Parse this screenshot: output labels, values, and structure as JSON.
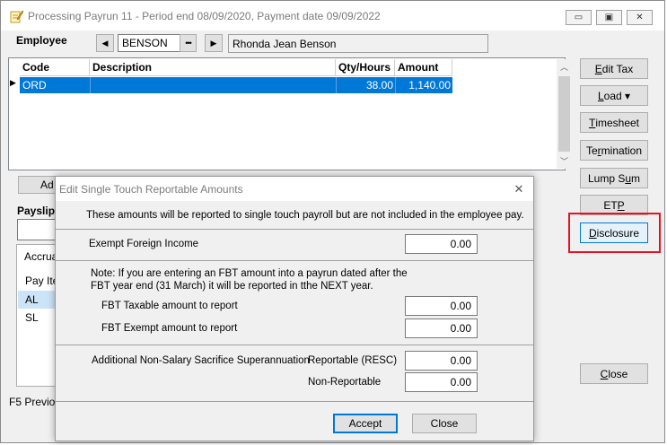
{
  "window": {
    "title": "Processing Payrun 11 - Period end 08/09/2020, Payment date 09/09/2022",
    "minimize_glyph": "▭",
    "restore_glyph": "▣",
    "close_glyph": "✕"
  },
  "employee": {
    "label": "Employee",
    "prev_glyph": "◀",
    "code": "BENSON",
    "lookup_glyph": "•••",
    "next_glyph": "▶",
    "name": "Rhonda Jean Benson"
  },
  "grid": {
    "columns": [
      "Code",
      "Description",
      "Qty/Hours",
      "Amount"
    ],
    "rows": [
      {
        "code": "ORD",
        "description": "",
        "qty": "38.00",
        "amount": "1,140.00",
        "selected": true
      }
    ],
    "row_marker": "▶"
  },
  "left_panel": {
    "add_button_partial": "Ad",
    "payslip_label_partial": "Payslip c",
    "accruals_tab_partial": "Accrua",
    "pay_items_header_partial": "Pay Ite",
    "items": [
      "AL",
      "SL"
    ]
  },
  "status_bar": {
    "text_partial": "F5 Previou"
  },
  "side_buttons": [
    {
      "pre": "",
      "accel": "E",
      "post": "dit Tax",
      "name": "edit-tax-button"
    },
    {
      "pre": "",
      "accel": "L",
      "post": "oad ▾",
      "name": "load-button"
    },
    {
      "pre": "",
      "accel": "T",
      "post": "imesheet",
      "name": "timesheet-button"
    },
    {
      "pre": "Te",
      "accel": "r",
      "post": "mination",
      "name": "termination-button"
    },
    {
      "pre": "Lump S",
      "accel": "u",
      "post": "m",
      "name": "lump-sum-button"
    },
    {
      "pre": "ET",
      "accel": "P",
      "post": "",
      "name": "etp-button"
    },
    {
      "pre": "",
      "accel": "D",
      "post": "isclosure",
      "name": "disclosure-button"
    },
    {
      "pre": "",
      "accel": "C",
      "post": "lose",
      "name": "close-main-button"
    }
  ],
  "dialog": {
    "title": "Edit Single Touch Reportable Amounts",
    "close_glyph": "✕",
    "intro": "These amounts will be reported to single touch payroll but are not included in the employee pay.",
    "exempt_foreign_income_label": "Exempt Foreign Income",
    "exempt_foreign_income_value": "0.00",
    "note_line1": "Note: If you are entering an FBT amount into a payrun dated after the",
    "note_line2": "FBT year end (31 March) it will be reported in tthe NEXT year.",
    "fbt_taxable_label": "FBT Taxable amount to report",
    "fbt_taxable_value": "0.00",
    "fbt_exempt_label": "FBT Exempt amount to report",
    "fbt_exempt_value": "0.00",
    "super_label": "Additional Non-Salary Sacrifice Superannuation",
    "reportable_label": "Reportable (RESC)",
    "reportable_value": "0.00",
    "non_reportable_label": "Non-Reportable",
    "non_reportable_value": "0.00",
    "accept_label": "Accept",
    "close_label": "Close"
  },
  "colors": {
    "selection": "#0078d7",
    "highlight_box": "#e81123",
    "default_button_border": "#0078d7"
  }
}
